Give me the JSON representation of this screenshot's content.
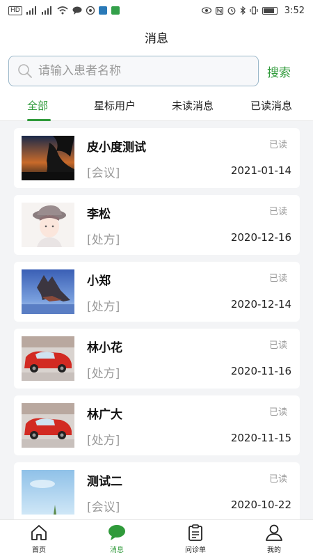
{
  "status_bar": {
    "left_icons": [
      "hd-icon",
      "signal-4g-icon",
      "signal-4g-icon",
      "wifi-icon",
      "chat-icon",
      "notification-icon",
      "app-icon",
      "app-icon"
    ],
    "hd_label": "HD",
    "time": "3:52"
  },
  "header": {
    "title": "消息"
  },
  "search": {
    "placeholder": "请输入患者名称",
    "value": "",
    "button_label": "搜索"
  },
  "tabs": [
    {
      "label": "全部",
      "active": true
    },
    {
      "label": "星标用户",
      "active": false
    },
    {
      "label": "未读消息",
      "active": false
    },
    {
      "label": "已读消息",
      "active": false
    }
  ],
  "messages": [
    {
      "name": "皮小度测试",
      "status": "已读",
      "type": "[会议]",
      "date": "2021-01-14",
      "avatar": "sunset-photo"
    },
    {
      "name": "李松",
      "status": "已读",
      "type": "[处方]",
      "date": "2020-12-16",
      "avatar": "cartoon-boy"
    },
    {
      "name": "小郑",
      "status": "已读",
      "type": "[处方]",
      "date": "2020-12-14",
      "avatar": "mountain-photo"
    },
    {
      "name": "林小花",
      "status": "已读",
      "type": "[处方]",
      "date": "2020-11-16",
      "avatar": "cars-toy"
    },
    {
      "name": "林广大",
      "status": "已读",
      "type": "[处方]",
      "date": "2020-11-15",
      "avatar": "cars-toy"
    },
    {
      "name": "测试二",
      "status": "已读",
      "type": "[会议]",
      "date": "2020-10-22",
      "avatar": "sky-photo"
    }
  ],
  "bottom_nav": [
    {
      "label": "首页",
      "icon": "home-icon",
      "active": false
    },
    {
      "label": "消息",
      "icon": "message-icon",
      "active": true
    },
    {
      "label": "问诊单",
      "icon": "clipboard-icon",
      "active": false
    },
    {
      "label": "我的",
      "icon": "user-icon",
      "active": false
    }
  ],
  "colors": {
    "accent": "#2f9a3a",
    "muted": "#999999",
    "background": "#f3f4f6"
  }
}
